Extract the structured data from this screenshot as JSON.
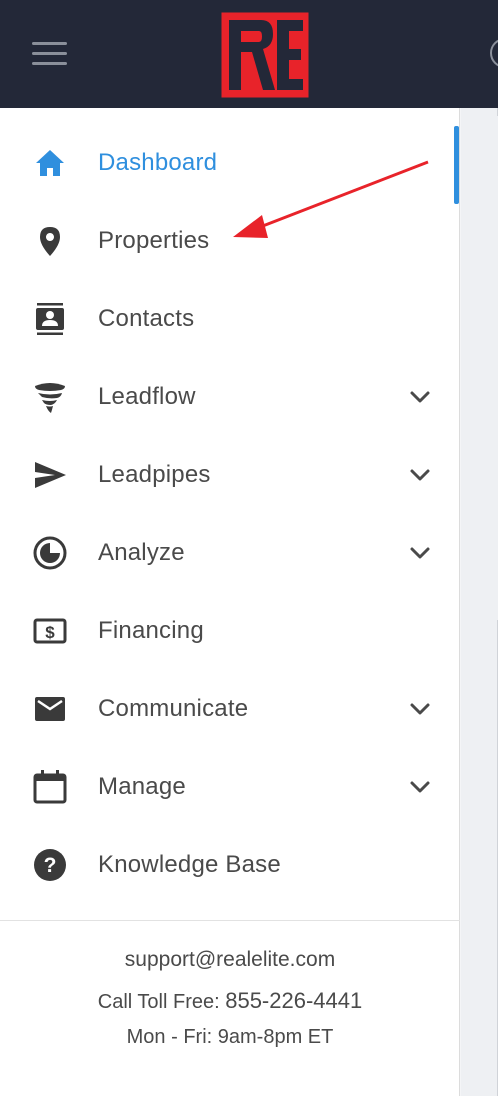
{
  "header": {
    "logo_text": "RE",
    "menu_icon": "hamburger-menu-icon",
    "brand_color": "#e8232a"
  },
  "nav": {
    "items": [
      {
        "label": "Dashboard",
        "icon": "home-icon",
        "active": true,
        "expandable": false
      },
      {
        "label": "Properties",
        "icon": "map-pin-icon",
        "active": false,
        "expandable": false
      },
      {
        "label": "Contacts",
        "icon": "contacts-icon",
        "active": false,
        "expandable": false
      },
      {
        "label": "Leadflow",
        "icon": "tornado-icon",
        "active": false,
        "expandable": true
      },
      {
        "label": "Leadpipes",
        "icon": "send-icon",
        "active": false,
        "expandable": true
      },
      {
        "label": "Analyze",
        "icon": "pie-chart-icon",
        "active": false,
        "expandable": true
      },
      {
        "label": "Financing",
        "icon": "dollar-icon",
        "active": false,
        "expandable": false
      },
      {
        "label": "Communicate",
        "icon": "mail-icon",
        "active": false,
        "expandable": true
      },
      {
        "label": "Manage",
        "icon": "calendar-icon",
        "active": false,
        "expandable": true
      },
      {
        "label": "Knowledge Base",
        "icon": "help-icon",
        "active": false,
        "expandable": false
      }
    ]
  },
  "footer": {
    "email": "support@realelite.com",
    "phone_prefix": "Call Toll Free: ",
    "phone": "855-226-4441",
    "hours": "Mon - Fri: 9am-8pm ET"
  },
  "colors": {
    "topbar": "#232838",
    "active": "#2f8fde",
    "text": "#4a4a4a",
    "icon": "#3a3a3a",
    "annotation_arrow": "#e8232a"
  }
}
